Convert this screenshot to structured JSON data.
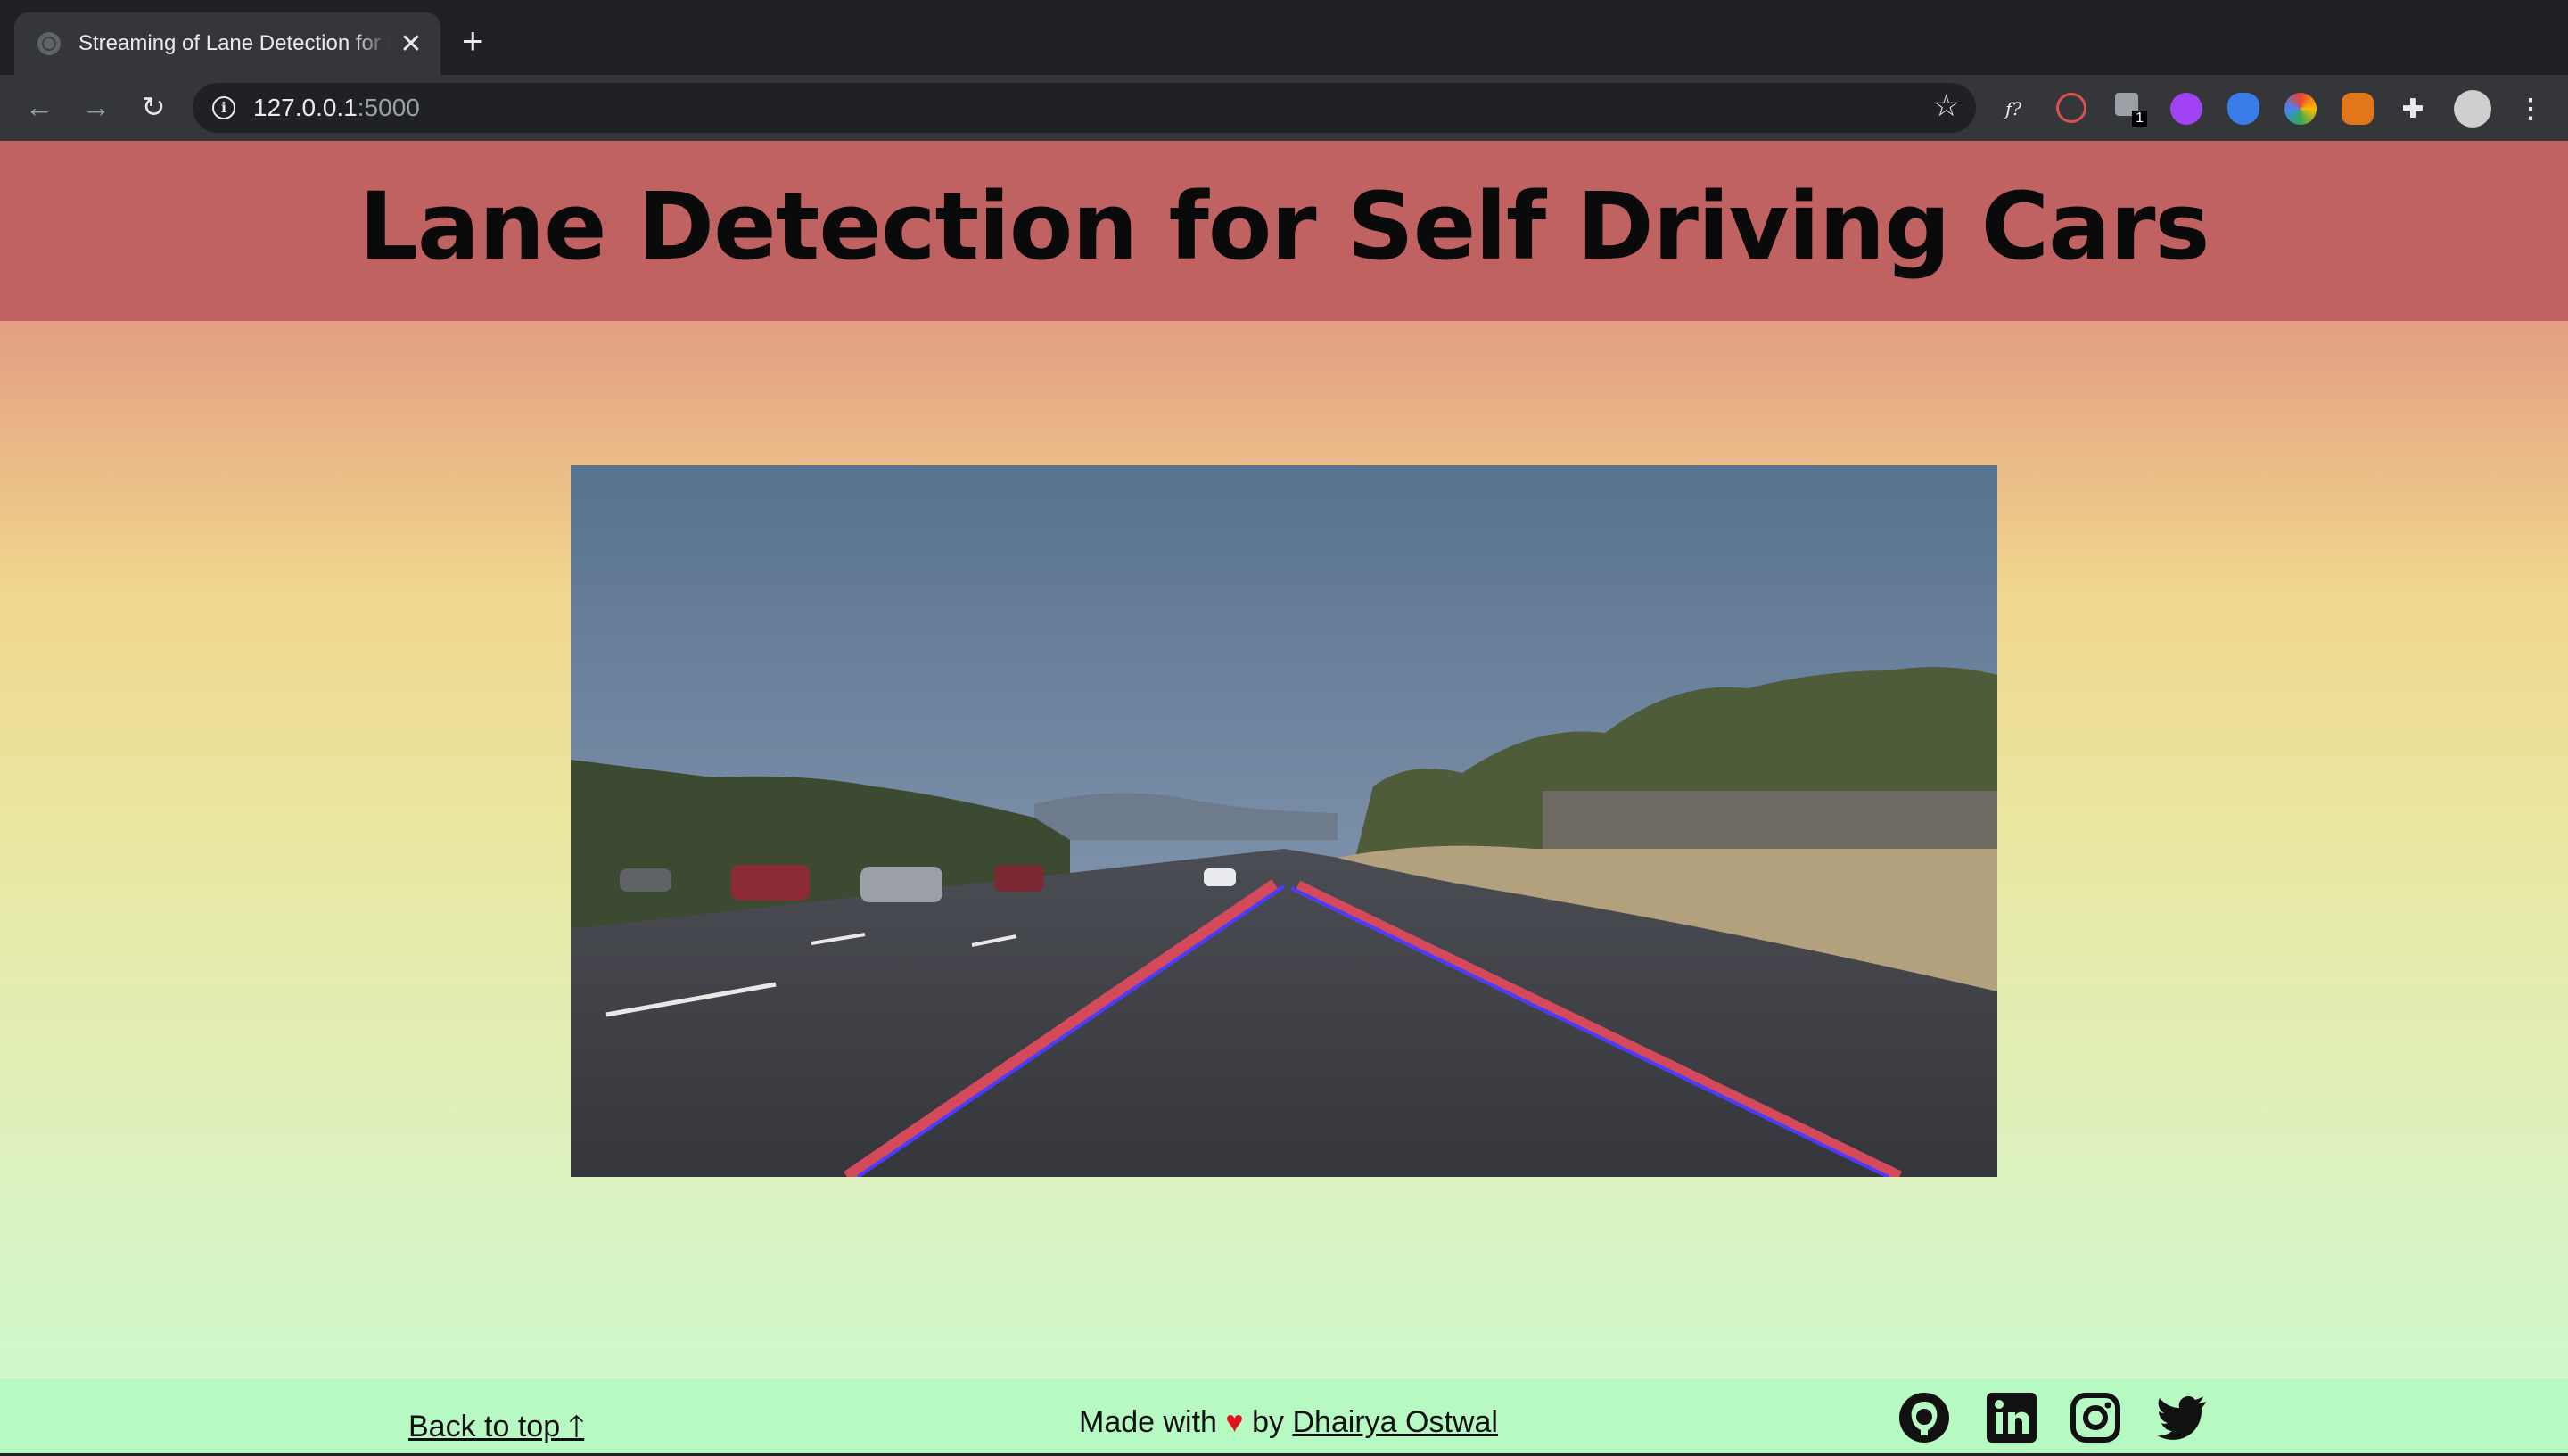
{
  "browser": {
    "tab_title": "Streaming of Lane Detection for Self Driving Cars",
    "tab_close": "✕",
    "new_tab": "+",
    "url_host": "127.0.0.1",
    "url_port": ":5000",
    "extensions": [
      "f?",
      "1"
    ]
  },
  "page": {
    "title": "Lane Detection for Self Driving Cars"
  },
  "footer": {
    "back_to_top": "Back to top",
    "made_with": "Made with",
    "heart": "♥",
    "by": "by",
    "author": "Dhairya Ostwal",
    "social": [
      "github-icon",
      "linkedin-icon",
      "instagram-icon",
      "twitter-icon"
    ]
  },
  "colors": {
    "header_band": "#c06162",
    "footer_band": "#b6f9c3",
    "heart": "#e0151b"
  }
}
